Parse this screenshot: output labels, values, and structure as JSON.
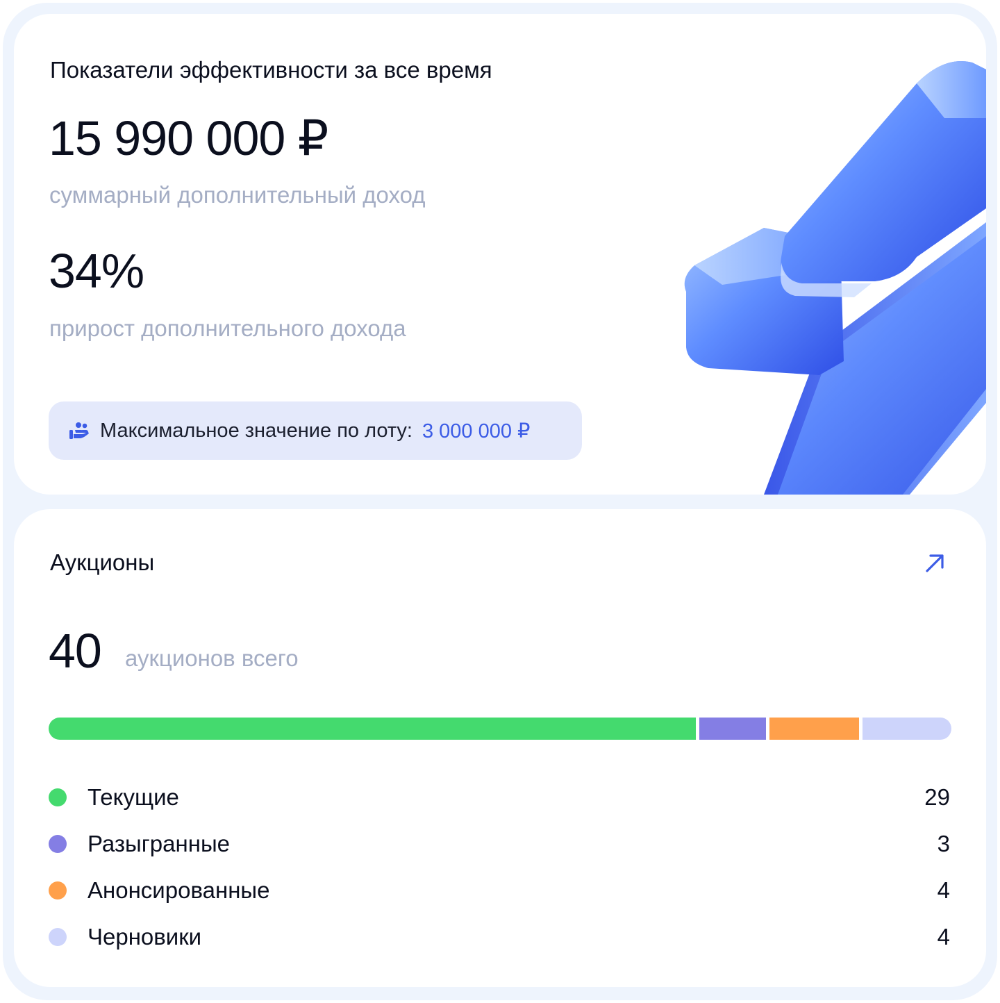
{
  "performance": {
    "title": "Показатели эффективности за все время",
    "total_revenue": "15 990 000 ₽",
    "total_revenue_caption": "суммарный дополнительный доход",
    "growth": "34%",
    "growth_caption": "прирост дополнительного дохода",
    "max_lot": {
      "icon": "hand-with-people-icon",
      "label": "Максимальное значение по лоту:",
      "value": "3 000 000 ₽"
    },
    "illustration": "lightning-bolt-icon"
  },
  "auctions": {
    "title": "Аукционы",
    "open_icon": "arrow-up-right-icon",
    "total": "40",
    "total_caption": "аукционов всего",
    "breakdown": [
      {
        "label": "Текущие",
        "value": "29",
        "count": 29,
        "color": "#44da6e"
      },
      {
        "label": "Разыгранные",
        "value": "3",
        "count": 3,
        "color": "#847ee4"
      },
      {
        "label": "Анонсированные",
        "value": "4",
        "count": 4,
        "color": "#ffa04b"
      },
      {
        "label": "Черновики",
        "value": "4",
        "count": 4,
        "color": "#cdd4fb"
      }
    ]
  },
  "colors": {
    "accent": "#3c5ce6",
    "muted_text": "#a4adc4",
    "pill_bg": "#e4e9fb"
  }
}
